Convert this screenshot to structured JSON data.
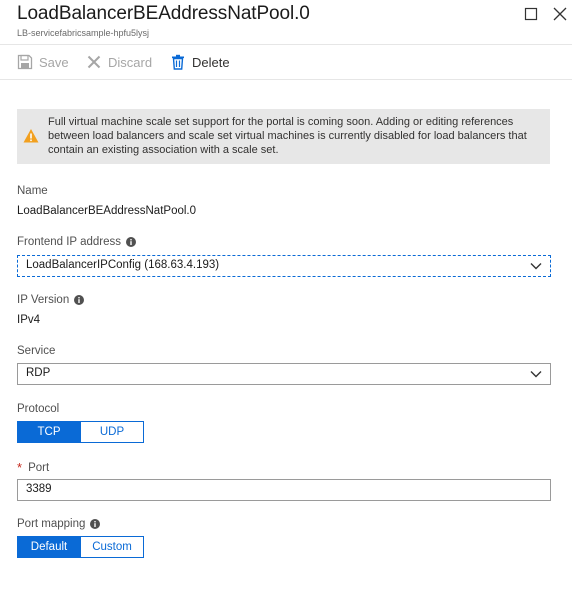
{
  "header": {
    "title": "LoadBalancerBEAddressNatPool.0",
    "subtitle": "LB-servicefabricsample-hpfu5lysj"
  },
  "toolbar": {
    "save_label": "Save",
    "discard_label": "Discard",
    "delete_label": "Delete"
  },
  "warning": {
    "text": "Full virtual machine scale set support for the portal is coming soon. Adding or editing references between load balancers and scale set virtual machines is currently disabled for load balancers that contain an existing association with a scale set."
  },
  "form": {
    "name_label": "Name",
    "name_value": "LoadBalancerBEAddressNatPool.0",
    "frontend_label": "Frontend IP address",
    "frontend_value": "LoadBalancerIPConfig (168.63.4.193)",
    "ipversion_label": "IP Version",
    "ipversion_value": "IPv4",
    "service_label": "Service",
    "service_value": "RDP",
    "protocol_label": "Protocol",
    "protocol_options": [
      "TCP",
      "UDP"
    ],
    "protocol_selected": "TCP",
    "port_required_mark": "*",
    "port_label": "Port",
    "port_value": "3389",
    "portmapping_label": "Port mapping",
    "portmapping_options": [
      "Default",
      "Custom"
    ],
    "portmapping_selected": "Default"
  },
  "colors": {
    "accent": "#0a6ad6",
    "warning_icon": "#f2a01f",
    "warning_bg": "#e7e7e7"
  },
  "icons": {
    "save": "save-icon",
    "discard": "discard-x-icon",
    "delete": "trash-icon",
    "warning": "warning-triangle-icon",
    "info": "info-icon",
    "chevron": "chevron-down-icon",
    "maximize": "maximize-icon",
    "close": "close-icon"
  }
}
